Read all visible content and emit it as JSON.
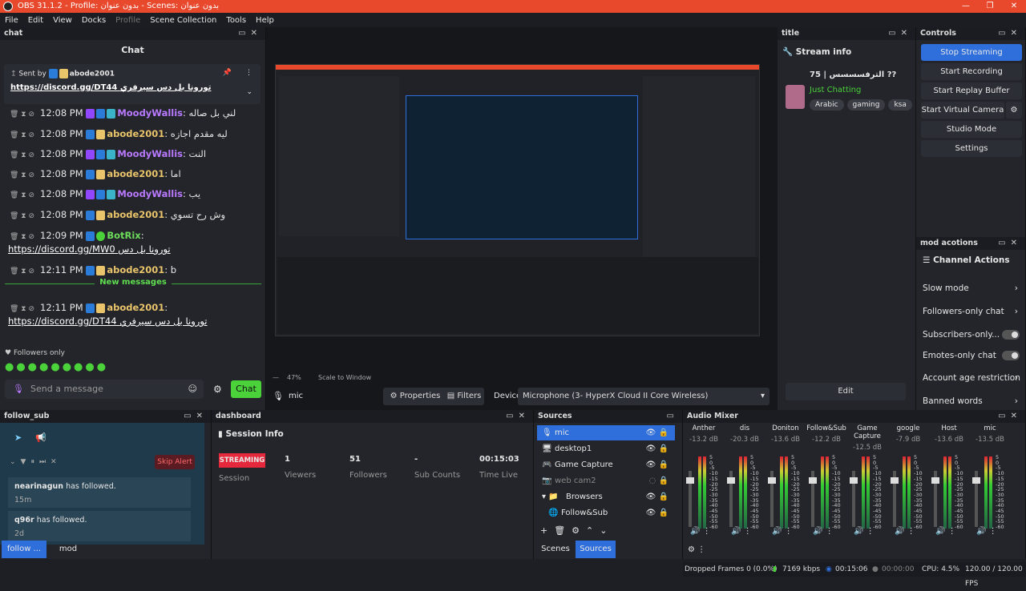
{
  "window": {
    "title": "OBS 31.1.2 - Profile: بدون عنوان - Scenes: بدون عنوان"
  },
  "menu": [
    "File",
    "Edit",
    "View",
    "Docks",
    "Profile",
    "Scene Collection",
    "Tools",
    "Help"
  ],
  "chat": {
    "dock_title": "chat",
    "heading": "Chat",
    "pinned_sent_by": "Sent by",
    "pinned_user": "abode2001",
    "pinned_text": "https://discord.gg/DT44 تورونا بل دس سيرفري",
    "messages": [
      {
        "time": "12:08 PM",
        "user": "MoodyWallis",
        "color": "p",
        "text": "لني بل صاله"
      },
      {
        "time": "12:08 PM",
        "user": "abode2001",
        "color": "y",
        "text": "ليه مقدم اجازه"
      },
      {
        "time": "12:08 PM",
        "user": "MoodyWallis",
        "color": "p",
        "text": "النت"
      },
      {
        "time": "12:08 PM",
        "user": "abode2001",
        "color": "y",
        "text": "اما"
      },
      {
        "time": "12:08 PM",
        "user": "MoodyWallis",
        "color": "p",
        "text": "يب"
      },
      {
        "time": "12:08 PM",
        "user": "abode2001",
        "color": "y",
        "text": "وش رح تسوي"
      },
      {
        "time": "12:09 PM",
        "user": "BotRix",
        "color": "g",
        "text": "",
        "line2": "https://discord.gg/MW0 تورونا بل دس"
      },
      {
        "time": "12:11 PM",
        "user": "abode2001",
        "color": "y",
        "text": "b"
      }
    ],
    "new_messages": "New messages",
    "last_msg": {
      "time": "12:11 PM",
      "user": "abode2001",
      "line2": "https://discord.gg/DT44 تورونا بل دس سيرفري"
    },
    "followers_only": "Followers only",
    "input_placeholder": "Send a message",
    "send_label": "Chat"
  },
  "preview": {
    "zoom": "47%",
    "scale": "Scale to Window",
    "source": "mic",
    "properties": "Properties",
    "filters": "Filters",
    "device_label": "Device",
    "device": "Microphone (3- HyperX Cloud II Core Wireless)"
  },
  "title_dock": {
    "title": "title",
    "stream_info": "Stream info",
    "stream_title": "الترفسسسس | 75 ??",
    "category": "Just Chatting",
    "tags": [
      "Arabic",
      "gaming",
      "ksa"
    ],
    "edit": "Edit"
  },
  "controls": {
    "title": "Controls",
    "buttons": [
      "Stop Streaming",
      "Start Recording",
      "Start Replay Buffer",
      "Start Virtual Camera",
      "Studio Mode",
      "Settings"
    ]
  },
  "mod_actions": {
    "title": "mod acotions",
    "heading": "Channel Actions",
    "rows": [
      "Slow mode",
      "Followers-only chat",
      "Subscribers-only...",
      "Emotes-only chat",
      "Account age restriction",
      "Banned words"
    ]
  },
  "follow_sub": {
    "title": "follow_sub",
    "skip": "Skip Alert",
    "events": [
      {
        "user": "nearinagun",
        "text": "has followed.",
        "time": "15m"
      },
      {
        "user": "q96r",
        "text": "has followed.",
        "time": "2d"
      }
    ],
    "tabs": [
      "follow ...",
      "mod"
    ]
  },
  "dashboard": {
    "title": "dashboard",
    "heading": "Session Info",
    "status": "STREAMING",
    "status_sub": "Session",
    "stats": [
      {
        "value": "1",
        "label": "Viewers"
      },
      {
        "value": "51",
        "label": "Followers"
      },
      {
        "value": "-",
        "label": "Sub Counts"
      },
      {
        "value": "00:15:03",
        "label": "Time Live"
      }
    ]
  },
  "sources": {
    "title": "Sources",
    "items": [
      "mic",
      "desktop1",
      "Game Capture",
      "web cam2",
      "Browsers",
      "Follow&Sub"
    ],
    "tabs": [
      "Scenes",
      "Sources"
    ]
  },
  "mixer": {
    "title": "Audio Mixer",
    "channels": [
      {
        "name": "Anther",
        "db": "-13.2 dB"
      },
      {
        "name": "dis",
        "db": "-20.3 dB"
      },
      {
        "name": "Doniton",
        "db": "-13.6 dB"
      },
      {
        "name": "Follow&Sub",
        "db": "-12.2 dB"
      },
      {
        "name": "Game Capture",
        "db": "-12.5 dB"
      },
      {
        "name": "google",
        "db": "-7.9 dB"
      },
      {
        "name": "Host",
        "db": "-13.6 dB"
      },
      {
        "name": "mic",
        "db": "-13.5 dB"
      }
    ],
    "scale": [
      "5",
      "0",
      "-5",
      "-10",
      "-15",
      "-20",
      "-25",
      "-30",
      "-35",
      "-40",
      "-45",
      "-50",
      "-55",
      "-60"
    ]
  },
  "status": {
    "dropped": "Dropped Frames 0 (0.0%)",
    "kbps": "7169 kbps",
    "live": "00:15:06",
    "rec": "00:00:00",
    "cpu": "CPU: 4.5%",
    "fps": "120.00 / 120.00 FPS"
  },
  "colors": {
    "accent": "#2f6fdc",
    "obs_red": "#e8482c",
    "green": "#4bd13a",
    "streaming": "#e5283c"
  }
}
